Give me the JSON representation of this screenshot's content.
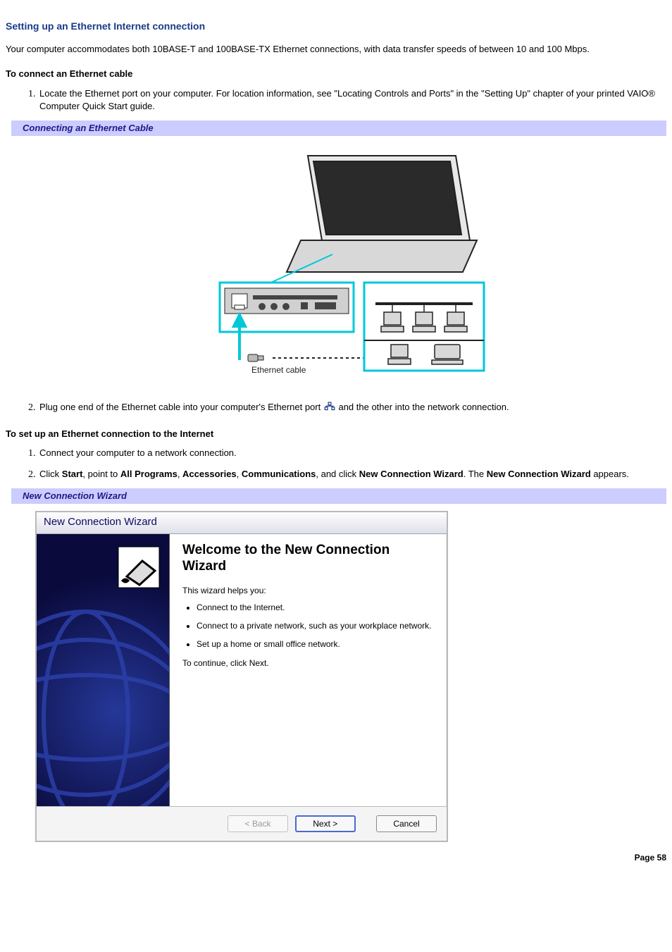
{
  "heading": "Setting up an Ethernet Internet connection",
  "intro": "Your computer accommodates both 10BASE-T and 100BASE-TX Ethernet connections, with data transfer speeds of between 10 and 100 Mbps.",
  "sectionA": {
    "title": "To connect an Ethernet cable",
    "step1": "Locate the Ethernet port on your computer. For location information, see \"Locating Controls and Ports\" in the \"Setting Up\" chapter of your printed VAIO® Computer Quick Start guide.",
    "caption": "Connecting an Ethernet Cable",
    "figure_label": "Ethernet cable",
    "step2_a": "Plug one end of the Ethernet cable into your computer's Ethernet port ",
    "step2_b": "and the other into the network connection."
  },
  "sectionB": {
    "title": "To set up an Ethernet connection to the Internet",
    "step1": "Connect your computer to a network connection.",
    "step2_pre": "Click ",
    "step2_start": "Start",
    "step2_mid1": ", point to ",
    "step2_allprograms": "All Programs",
    "step2_comma1": ", ",
    "step2_accessories": "Accessories",
    "step2_comma2": ", ",
    "step2_communications": "Communications",
    "step2_mid2": ", and click ",
    "step2_wizard": "New Connection Wizard",
    "step2_mid3": ". The ",
    "step2_wizard2": "New Connection Wizard",
    "step2_end": " appears.",
    "caption": "New Connection Wizard"
  },
  "wizard": {
    "title": "New Connection Wizard",
    "heading": "Welcome to the New Connection Wizard",
    "intro": "This wizard helps you:",
    "bullets": [
      "Connect to the Internet.",
      "Connect to a private network, such as your workplace network.",
      "Set up a home or small office network."
    ],
    "continue": "To continue, click Next.",
    "buttons": {
      "back": "< Back",
      "next": "Next >",
      "cancel": "Cancel"
    }
  },
  "page_label": "Page 58"
}
